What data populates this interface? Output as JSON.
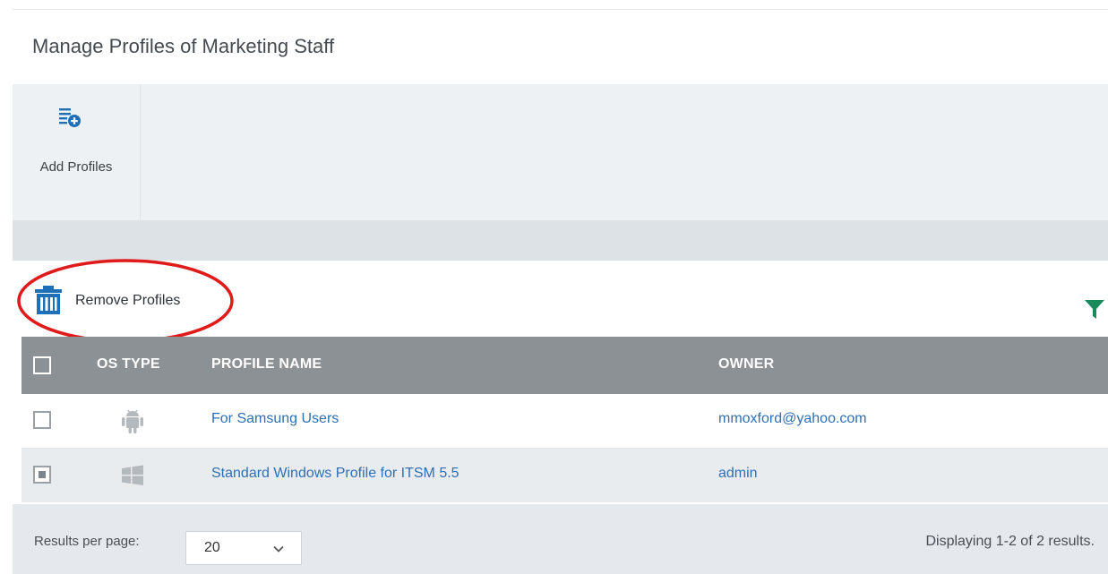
{
  "page": {
    "title": "Manage Profiles of Marketing Staff"
  },
  "toolbar": {
    "add_profiles_label": "Add Profiles",
    "add_profiles_icon": "add-list-icon"
  },
  "actions": {
    "remove_profiles_label": "Remove Profiles",
    "remove_profiles_icon": "trash-icon",
    "filter_icon": "filter-icon"
  },
  "table": {
    "headers": {
      "os_type": "OS TYPE",
      "profile_name": "PROFILE NAME",
      "owner": "OWNER"
    },
    "rows": [
      {
        "os_icon": "android-icon",
        "profile_name": "For Samsung Users",
        "owner": "mmoxford@yahoo.com",
        "checked": false
      },
      {
        "os_icon": "windows-icon",
        "profile_name": "Standard Windows Profile for ITSM 5.5",
        "owner": "admin",
        "checked": true
      }
    ]
  },
  "pagination": {
    "results_per_page_label": "Results per page:",
    "results_per_page_value": "20",
    "summary": "Displaying 1-2 of 2 results."
  },
  "colors": {
    "accent_blue": "#1f6fb7",
    "filter_green": "#1a8a5a",
    "header_gray": "#8c9196",
    "annotation_red": "#e01b1b"
  }
}
